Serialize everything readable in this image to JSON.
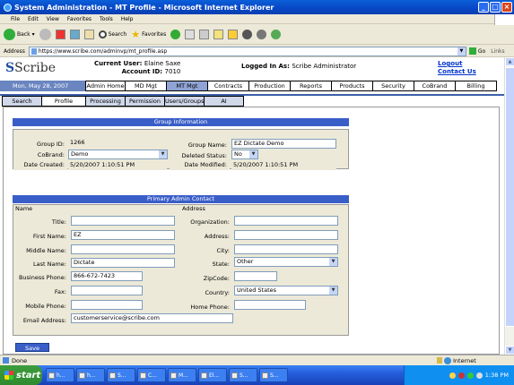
{
  "window": {
    "title": "System Administration - MT Profile - Microsoft Internet Explorer"
  },
  "menu": [
    "File",
    "Edit",
    "View",
    "Favorites",
    "Tools",
    "Help"
  ],
  "toolbar": {
    "back": "Back",
    "search": "Search",
    "favorites": "Favorites"
  },
  "address": {
    "label": "Address",
    "url": "https://www.scribe.com/adminvp/mt_profile.asp",
    "go": "Go",
    "links": "Links"
  },
  "header": {
    "logo": "Scribe",
    "current_user_label": "Current User:",
    "current_user": "Elaine Saxe",
    "account_label": "Account ID:",
    "account_id": "7010",
    "logged_in_label": "Logged In As:",
    "logged_in": "Scribe Administrator",
    "logout": "Logout",
    "contact": "Contact Us"
  },
  "nav": {
    "date": "Mon, May 28, 2007",
    "tabs": [
      "Admin Home",
      "MD Mgt",
      "MT Mgt",
      "Contracts",
      "Production",
      "Reports",
      "Products",
      "Security",
      "CoBrand",
      "Billing"
    ],
    "active": "MT Mgt"
  },
  "subnav": {
    "tabs": [
      "Search",
      "Profile",
      "Processing",
      "Permission",
      "Users/Groups",
      "AI"
    ],
    "active": "Profile"
  },
  "group": {
    "header": "Group Information",
    "group_id_label": "Group ID:",
    "group_id": "1266",
    "group_name_label": "Group Name:",
    "group_name": "EZ Dictate Demo",
    "cobrand_label": "CoBrand:",
    "cobrand": "Demo",
    "deleted_label": "Deleted Status:",
    "deleted": "No",
    "created_label": "Date Created:",
    "created": "5/20/2007 1:10:51 PM",
    "modified_label": "Date Modified:",
    "modified": "5/20/2007 1:10:51 PM"
  },
  "contact": {
    "header": "Primary Admin Contact",
    "name_col": "Name",
    "address_col": "Address",
    "title_label": "Title:",
    "title": "",
    "first_label": "First Name:",
    "first": "EZ",
    "middle_label": "Middle Name:",
    "middle": "",
    "last_label": "Last Name:",
    "last": "Dictate",
    "bphone_label": "Business Phone:",
    "bphone": "866-672-7423",
    "fax_label": "Fax:",
    "fax": "",
    "mobile_label": "Mobile Phone:",
    "mobile": "",
    "email_label": "Email Address:",
    "email": "customerservice@scribe.com",
    "org_label": "Organization:",
    "org": "",
    "address_label": "Address:",
    "address": "",
    "city_label": "City:",
    "city": "",
    "state_label": "State:",
    "state": "Other",
    "zip_label": "ZipCode:",
    "zip": "",
    "country_label": "Country:",
    "country": "United States",
    "home_label": "Home Phone:",
    "home": ""
  },
  "save": "Save",
  "status": {
    "left": "Done",
    "zone": "Internet"
  },
  "taskbar": {
    "start": "start",
    "tasks": [
      "h...",
      "h...",
      "S...",
      "C...",
      "M...",
      "El...",
      "S...",
      "S..."
    ],
    "clock": "1:38 PM"
  }
}
